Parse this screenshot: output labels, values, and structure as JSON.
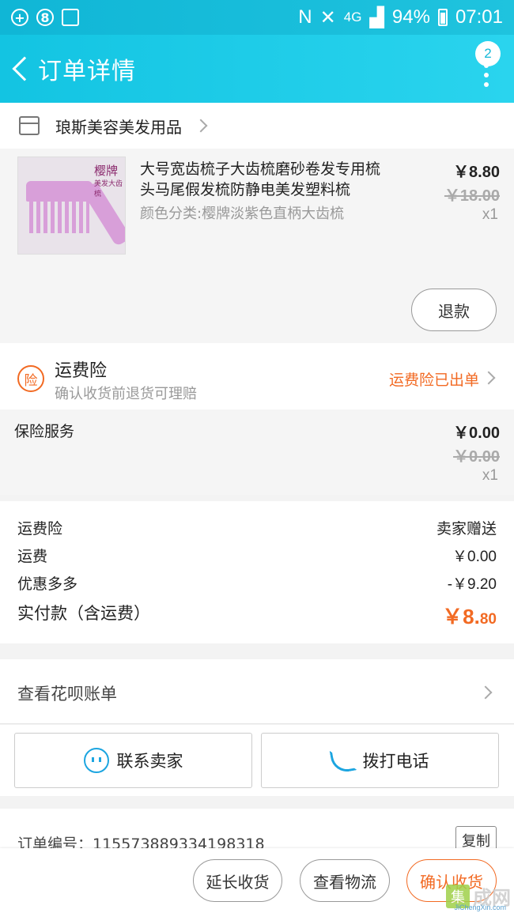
{
  "status_bar": {
    "network": "4G",
    "battery": "94%",
    "time": "07:01"
  },
  "header": {
    "title": "订单详情",
    "badge": "2"
  },
  "shop": {
    "name": "琅斯美容美发用品"
  },
  "item": {
    "title": "大号宽齿梳子大齿梳磨砂卷发专用梳头马尾假发梳防静电美发塑料梳",
    "sku": "颜色分类:樱牌淡紫色直柄大齿梳",
    "price": "￥8.80",
    "original_price": "￥18.00",
    "qty": "x1",
    "refund_label": "退款",
    "thumb_brand": "樱牌",
    "thumb_subtitle": "美发大齿梳"
  },
  "shipping_insurance": {
    "icon_text": "险",
    "title": "运费险",
    "description": "确认收货前退货可理赔",
    "status": "运费险已出单"
  },
  "insurance_service": {
    "name": "保险服务",
    "price": "￥0.00",
    "original_price": "￥0.00",
    "qty": "x1"
  },
  "summary": {
    "rows": [
      {
        "label": "运费险",
        "value": "卖家赠送"
      },
      {
        "label": "运费",
        "value": "￥0.00"
      },
      {
        "label": "优惠多多",
        "value": "-￥9.20"
      }
    ],
    "total_label": "实付款（含运费）",
    "total_main": "￥8.",
    "total_cents": "80"
  },
  "huabei": {
    "label": "查看花呗账单"
  },
  "actions": {
    "contact": "联系卖家",
    "call": "拨打电话"
  },
  "order": {
    "number_text": "订单编号：115573889334198318",
    "copy_label": "复制"
  },
  "bottom_bar": {
    "extend": "延长收货",
    "logistics": "查看物流",
    "confirm": "确认收货"
  },
  "watermark": {
    "logo_char": "集",
    "text": "成网",
    "url": "JiChengXin.com"
  }
}
